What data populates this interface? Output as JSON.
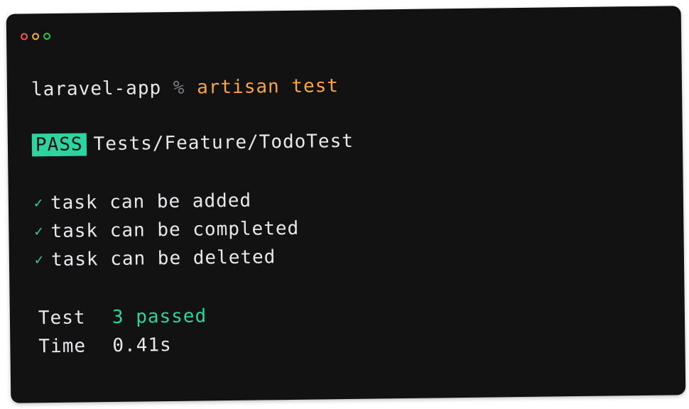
{
  "colors": {
    "red": "#f05a4e",
    "yellow": "#f2b33a",
    "green": "#34c24a",
    "orange": "#f7a44a",
    "teal": "#2ed4a0"
  },
  "window": {
    "controls": [
      "close-icon",
      "minimize-icon",
      "maximize-icon"
    ]
  },
  "prompt": {
    "directory": "laravel-app",
    "symbol": "%",
    "command": "artisan test"
  },
  "result": {
    "badge": "PASS",
    "suite": "Tests/Feature/TodoTest"
  },
  "tests": [
    {
      "icon": "check-icon",
      "glyph": "✓",
      "name": "task can be added"
    },
    {
      "icon": "check-icon",
      "glyph": "✓",
      "name": "task can be completed"
    },
    {
      "icon": "check-icon",
      "glyph": "✓",
      "name": "task can be deleted"
    }
  ],
  "summary": {
    "tests_label": "Test",
    "tests_value": "3 passed",
    "time_label": "Time",
    "time_value": "0.41s"
  }
}
